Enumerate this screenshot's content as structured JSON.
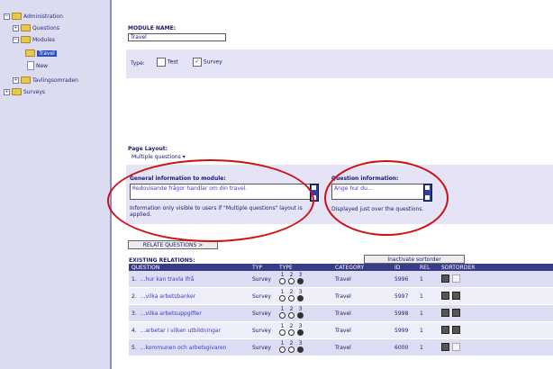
{
  "sidebar": {
    "items": [
      {
        "label": "Administration"
      },
      {
        "label": "Questions"
      },
      {
        "label": "Modules"
      },
      {
        "label": "Travel"
      },
      {
        "label": "New"
      },
      {
        "label": "Tavlingsomraden"
      },
      {
        "label": "Surveys"
      }
    ]
  },
  "form": {
    "module_name_label": "MODULE NAME:",
    "module_name_value": "Travel",
    "types_label": "Type:",
    "type_test_label": "Test",
    "type_survey_label": "Survey",
    "page_layout_label": "Page Layout:",
    "page_layout_value": "Multiple questions",
    "general_info_label": "General information to module:",
    "general_info_value": "Redovisande frågor handlar om din travel.",
    "general_info_note": "Information only visible to users if \"Multiple questions\" layout is applied.",
    "question_info_label": "Question information:",
    "question_info_value": "Ange hur du...",
    "question_info_note": "Displayed just over the questions."
  },
  "buttons": {
    "relate_questions": "RELATE QUESTIONS >",
    "inactivate_sortorder": "Inactivate sortorder"
  },
  "table": {
    "title": "EXISTING RELATIONS:",
    "headers": [
      "QUESTION",
      "TYP",
      "TYPE",
      "CATEGORY",
      "ID",
      "REL",
      "SORTORDER"
    ],
    "rows": [
      {
        "num": "1.",
        "question": "...hur kan travla ifrå",
        "typ": "Survey",
        "category": "Travel",
        "id": "5996",
        "rel": "1"
      },
      {
        "num": "2.",
        "question": "...vilka arbetsbanker",
        "typ": "Survey",
        "category": "Travel",
        "id": "5997",
        "rel": "1"
      },
      {
        "num": "3.",
        "question": "...vilka arbetsuppgifter",
        "typ": "Survey",
        "category": "Travel",
        "id": "5998",
        "rel": "1"
      },
      {
        "num": "4.",
        "question": "...arbetar i vilken utbildningar",
        "typ": "Survey",
        "category": "Travel",
        "id": "5999",
        "rel": "1"
      },
      {
        "num": "5.",
        "question": "...kommunen och arbetsgivaren",
        "typ": "Survey",
        "category": "Travel",
        "id": "6000",
        "rel": "1"
      }
    ],
    "type_radio_labels": [
      "1",
      "2",
      "3"
    ]
  },
  "colors": {
    "sidebar_bg": "#dcdcf0",
    "header_bg": "#3a3a8a",
    "highlight_red": "#d01010"
  }
}
